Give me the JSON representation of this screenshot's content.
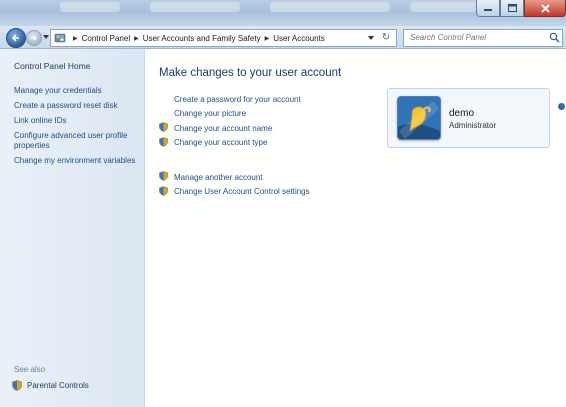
{
  "window": {
    "controls": {
      "minimize_icon": "minimize-icon",
      "maximize_icon": "maximize-icon",
      "close_icon": "close-icon"
    }
  },
  "address_bar": {
    "breadcrumb": [
      "Control Panel",
      "User Accounts and Family Safety",
      "User Accounts"
    ],
    "search_placeholder": "Search Control Panel"
  },
  "left_pane": {
    "home": "Control Panel Home",
    "links": [
      "Manage your credentials",
      "Create a password reset disk",
      "Link online IDs",
      "Configure advanced user profile properties",
      "Change my environment variables"
    ],
    "see_also": "See also",
    "parental_controls": "Parental Controls"
  },
  "main": {
    "heading": "Make changes to your user account",
    "actions": [
      {
        "label": "Create a password for your account",
        "shield": false
      },
      {
        "label": "Change your picture",
        "shield": false
      },
      {
        "label": "Change your account name",
        "shield": true
      },
      {
        "label": "Change your account type",
        "shield": true
      }
    ],
    "other_actions": [
      {
        "label": "Manage another account",
        "shield": true
      },
      {
        "label": "Change User Account Control settings",
        "shield": true
      }
    ]
  },
  "account_card": {
    "name": "demo",
    "role": "Administrator"
  },
  "colors": {
    "link": "#1e4e8c",
    "heading": "#1e3a6e",
    "left_pane": "#dbe6f3"
  }
}
